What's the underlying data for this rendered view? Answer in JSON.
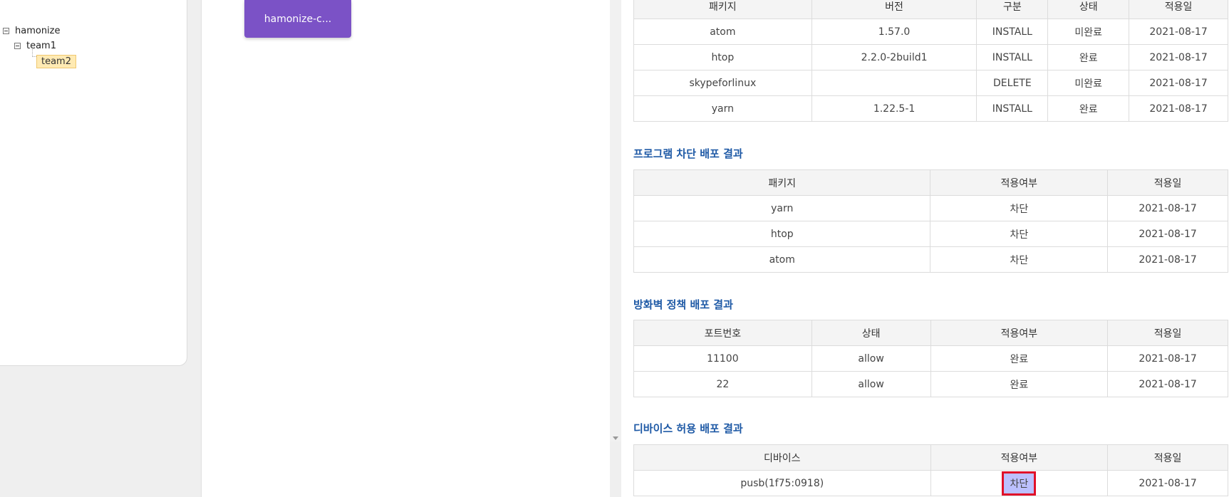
{
  "tree": {
    "root": "hamonize",
    "child": "team1",
    "grandchild": "team2"
  },
  "pc_card": {
    "label": "hamonize-c..."
  },
  "package_result": {
    "headers": [
      "패키지",
      "버전",
      "구분",
      "상태",
      "적용일"
    ],
    "rows": [
      [
        "atom",
        "1.57.0",
        "INSTALL",
        "미완료",
        "2021-08-17"
      ],
      [
        "htop",
        "2.2.0-2build1",
        "INSTALL",
        "완료",
        "2021-08-17"
      ],
      [
        "skypeforlinux",
        "",
        "DELETE",
        "미완료",
        "2021-08-17"
      ],
      [
        "yarn",
        "1.22.5-1",
        "INSTALL",
        "완료",
        "2021-08-17"
      ]
    ]
  },
  "block_result": {
    "title": "프로그램 차단 배포 결과",
    "headers": [
      "패키지",
      "적용여부",
      "적용일"
    ],
    "rows": [
      [
        "yarn",
        "차단",
        "2021-08-17"
      ],
      [
        "htop",
        "차단",
        "2021-08-17"
      ],
      [
        "atom",
        "차단",
        "2021-08-17"
      ]
    ]
  },
  "firewall_result": {
    "title": "방화벽 정책 배포 결과",
    "headers": [
      "포트번호",
      "상태",
      "적용여부",
      "적용일"
    ],
    "rows": [
      [
        "11100",
        "allow",
        "완료",
        "2021-08-17"
      ],
      [
        "22",
        "allow",
        "완료",
        "2021-08-17"
      ]
    ]
  },
  "device_result": {
    "title": "디바이스 허용 배포 결과",
    "headers": [
      "디바이스",
      "적용여부",
      "적용일"
    ],
    "rows": [
      [
        "pusb(1f75:0918)",
        "차단",
        "2021-08-17"
      ]
    ]
  },
  "colors": {
    "accent_purple": "#7b52c6",
    "section_title": "#1f5aa6",
    "highlight_bg": "#bcc0ff",
    "highlight_border": "#e0102a",
    "selected_node_bg": "#ffeab3"
  }
}
